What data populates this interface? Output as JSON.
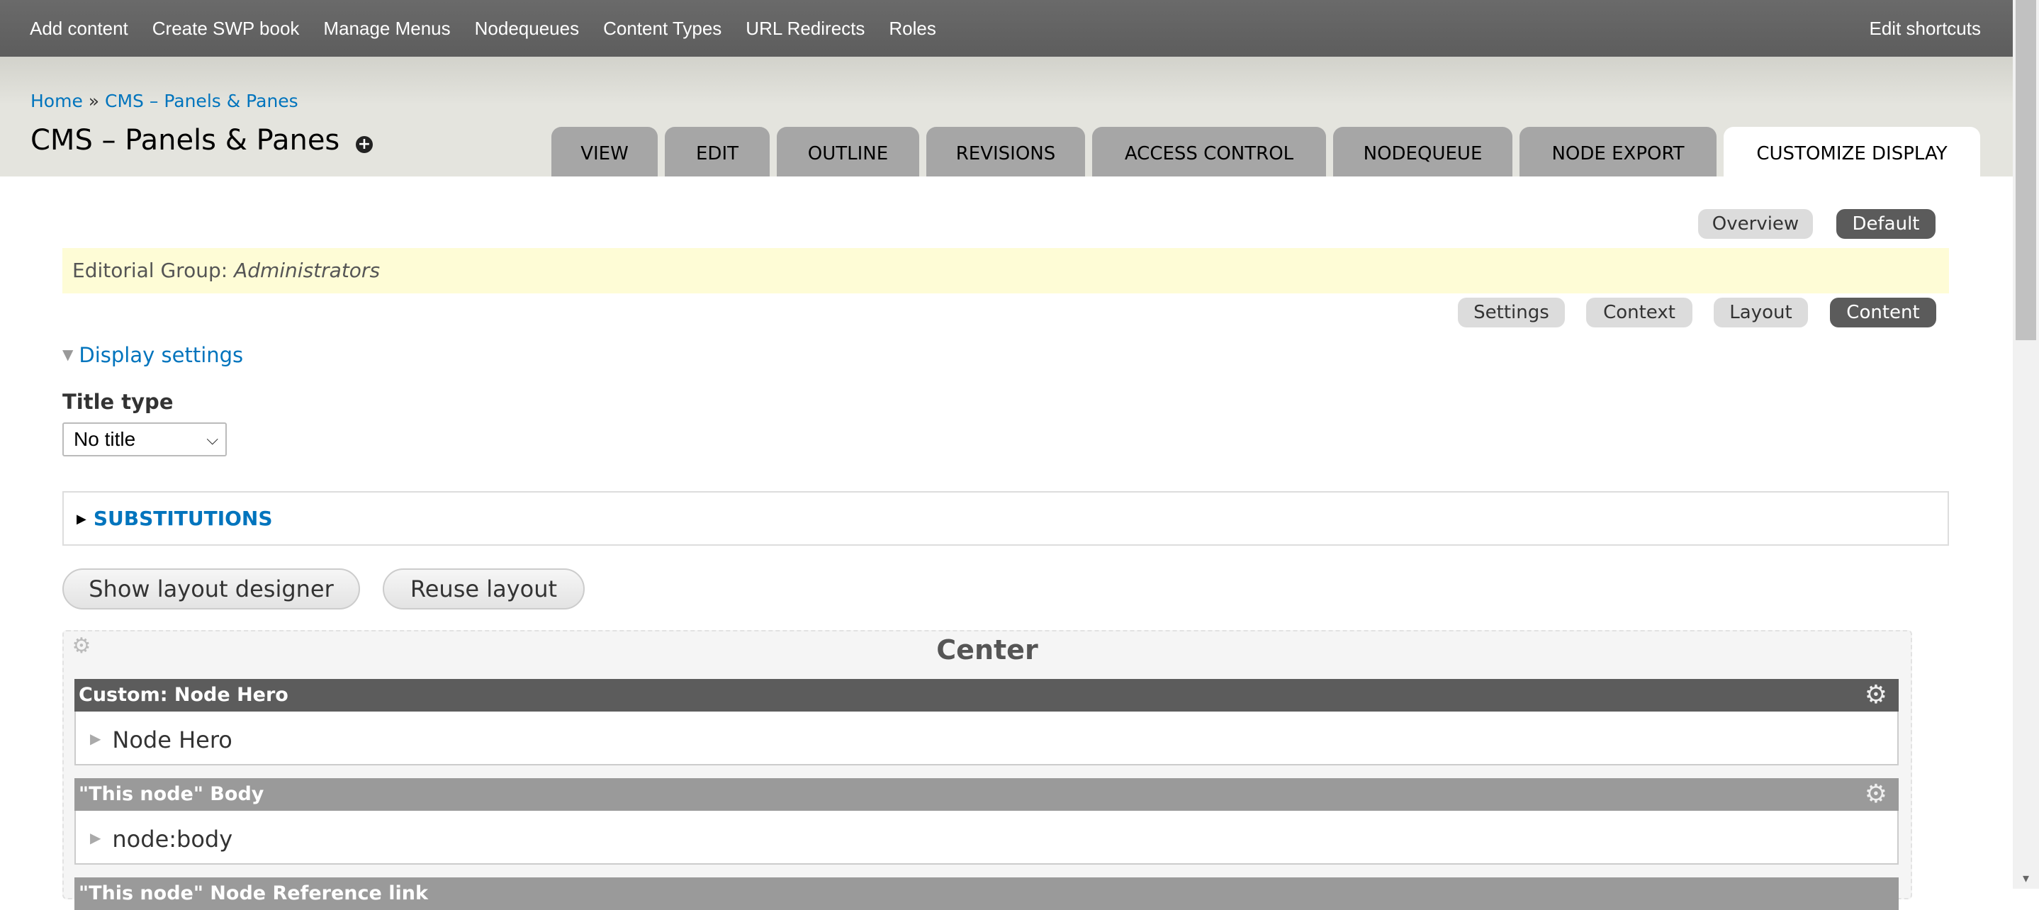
{
  "toolbar": {
    "links": [
      "Add content",
      "Create SWP book",
      "Manage Menus",
      "Nodequeues",
      "Content Types",
      "URL Redirects",
      "Roles"
    ],
    "edit_shortcuts": "Edit shortcuts"
  },
  "breadcrumb": {
    "home": "Home",
    "separator": "»",
    "current": "CMS – Panels & Panes"
  },
  "page_title": "CMS – Panels & Panes",
  "tabs": [
    "View",
    "Edit",
    "Outline",
    "Revisions",
    "Access control",
    "Nodequeue",
    "Node export",
    "Customize display"
  ],
  "active_tab": "Customize display",
  "secondary_tabs": [
    "Overview",
    "Default"
  ],
  "editorial": {
    "label": "Editorial Group:",
    "value": "Administrators"
  },
  "panel_tabs": [
    "Settings",
    "Context",
    "Layout",
    "Content"
  ],
  "display_settings_label": "Display settings",
  "title_type": {
    "label": "Title type",
    "value": "No title"
  },
  "substitutions_label": "SUBSTITUTIONS",
  "buttons": {
    "show_layout_designer": "Show layout designer",
    "reuse_layout": "Reuse layout"
  },
  "region": {
    "title": "Center",
    "panes": [
      {
        "title": "Custom: Node Hero",
        "body": "Node Hero",
        "title_color": "#5c5c5c"
      },
      {
        "title": "\"This node\" Body",
        "body": "node:body",
        "title_color": "#9a9a9a"
      },
      {
        "title": "\"This node\" Node Reference link",
        "body": "",
        "title_color": "#9a9a9a"
      }
    ]
  },
  "colors": {
    "link": "#0074bd",
    "toolbar": "#636363",
    "active_pill": "#5b5b5b",
    "notice": "#fefcd6"
  }
}
